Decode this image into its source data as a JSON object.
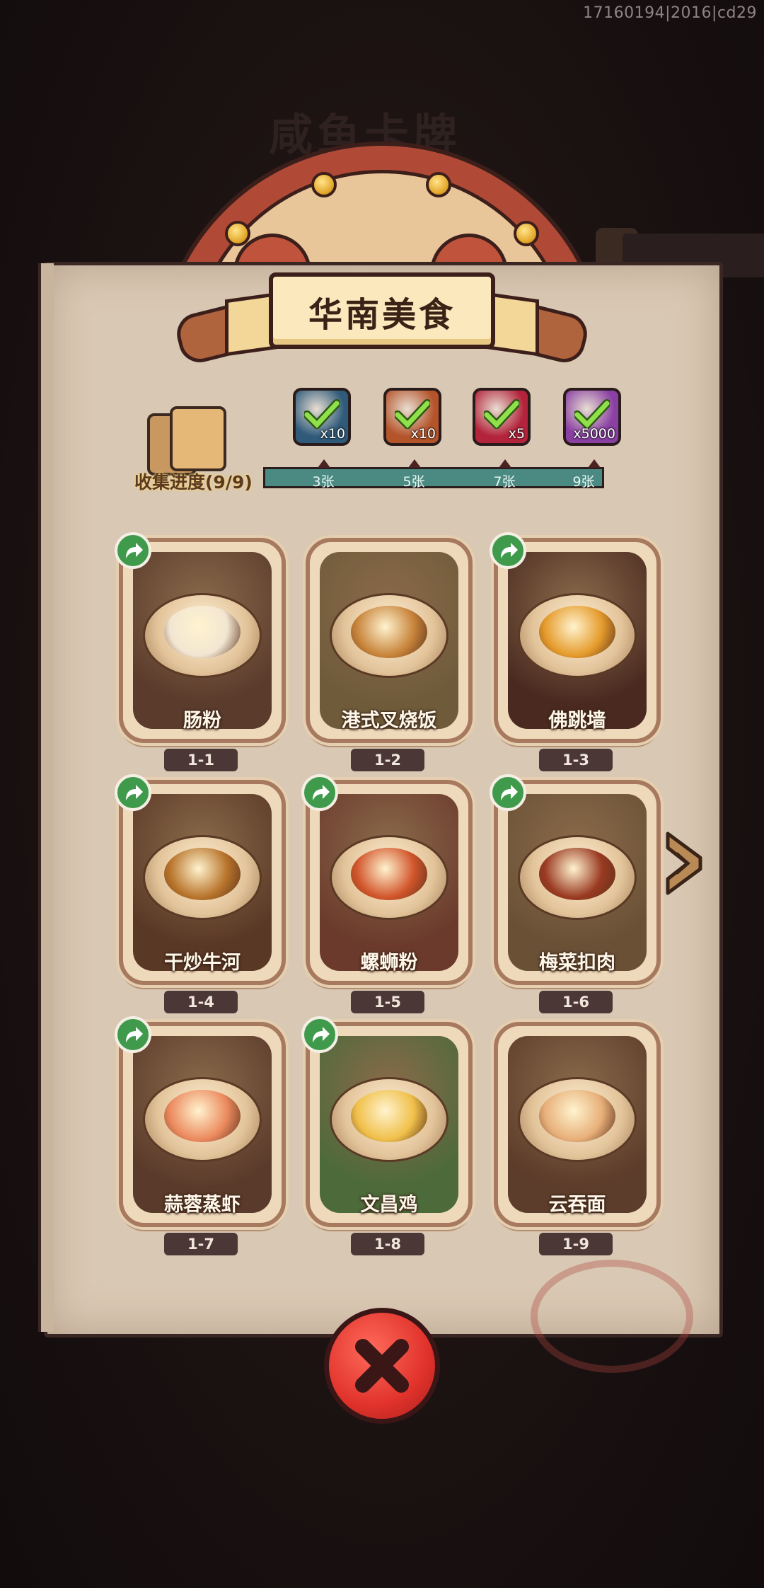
{
  "build_id": "17160194|2016|cd29",
  "background_title": "咸鱼卡牌",
  "banner": {
    "title": "华南美食"
  },
  "collection": {
    "label": "收集进度(9/9)",
    "progress": 1.0,
    "milestones": [
      {
        "label": "3张",
        "reward_icon": "green-chest-icon",
        "reward_qty": "x10",
        "color": "#2f5a7a"
      },
      {
        "label": "5张",
        "reward_icon": "scroll-icon",
        "reward_qty": "x10",
        "color": "#b4542b"
      },
      {
        "label": "7张",
        "reward_icon": "rainbow-gem-icon",
        "reward_qty": "x5",
        "color": "#b3243c"
      },
      {
        "label": "9张",
        "reward_icon": "purple-crystal-icon",
        "reward_qty": "x5000",
        "color": "#8a3fa3"
      }
    ]
  },
  "cards": [
    {
      "name": "肠粉",
      "num": "1-1",
      "shareable": true,
      "bg": "#5a3b2c",
      "food": "#f2e6d2"
    },
    {
      "name": "港式叉烧饭",
      "num": "1-2",
      "shareable": false,
      "bg": "#6f5b3a",
      "food": "#c8843b"
    },
    {
      "name": "佛跳墙",
      "num": "1-3",
      "shareable": true,
      "bg": "#4a2a20",
      "food": "#e59b2c"
    },
    {
      "name": "干炒牛河",
      "num": "1-4",
      "shareable": true,
      "bg": "#5a3826",
      "food": "#b8742b"
    },
    {
      "name": "螺蛳粉",
      "num": "1-5",
      "shareable": true,
      "bg": "#6b3a2c",
      "food": "#d2552b"
    },
    {
      "name": "梅菜扣肉",
      "num": "1-6",
      "shareable": true,
      "bg": "#6a5136",
      "food": "#9a3a22"
    },
    {
      "name": "蒜蓉蒸虾",
      "num": "1-7",
      "shareable": true,
      "bg": "#5a3a2a",
      "food": "#ec8a5e"
    },
    {
      "name": "文昌鸡",
      "num": "1-8",
      "shareable": true,
      "bg": "#4c6a3a",
      "food": "#f0c04a"
    },
    {
      "name": "云吞面",
      "num": "1-9",
      "shareable": false,
      "bg": "#5c3c2a",
      "food": "#e8b07a"
    }
  ],
  "icons": {
    "share": "share-arrow-icon",
    "next": "next-page-arrow-icon",
    "close": "close-x-icon"
  }
}
